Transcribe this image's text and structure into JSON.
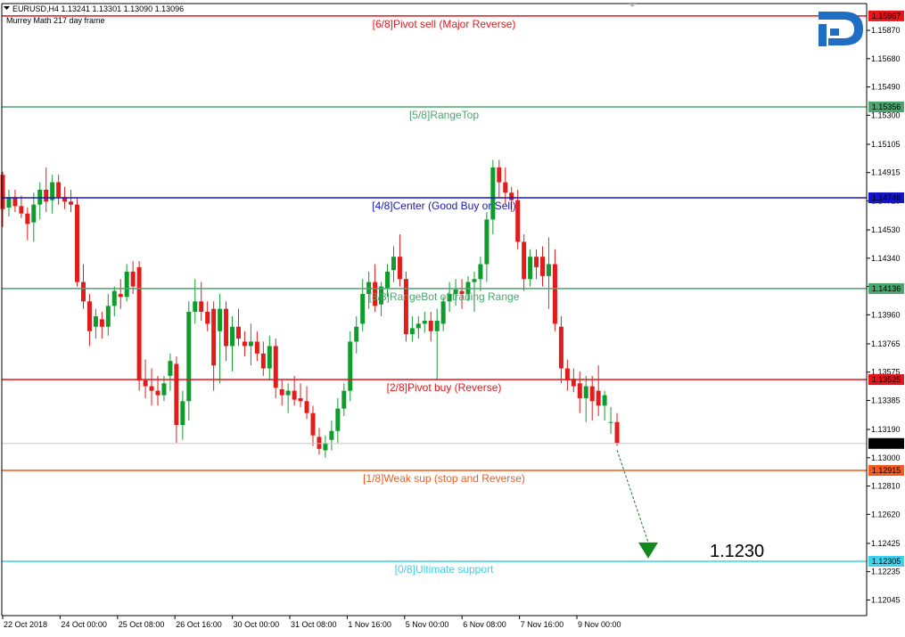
{
  "header": {
    "symbol_line": "EURUSD,H4  1.13241 1.13301 1.13090 1.13096",
    "indicator_name": "Murrey Math 217 day frame"
  },
  "chart_data": {
    "type": "candlestick",
    "symbol": "EURUSD",
    "timeframe": "H4",
    "ohlc_header": {
      "open": 1.13241,
      "high": 1.13301,
      "low": 1.1309,
      "close": 1.13096
    },
    "current_price": 1.13096,
    "ylim": [
      1.1194,
      1.1605
    ],
    "y_ticks": [
      "1.15870",
      "1.15680",
      "1.15490",
      "1.15300",
      "1.15105",
      "1.14915",
      "1.14725",
      "1.14530",
      "1.14340",
      "1.14150",
      "1.13960",
      "1.13765",
      "1.13575",
      "1.13385",
      "1.13190",
      "1.13000",
      "1.12810",
      "1.12620",
      "1.12425",
      "1.12235",
      "1.12045"
    ],
    "x_labels": [
      "22 Oct 2018",
      "24 Oct 00:00",
      "25 Oct 08:00",
      "26 Oct 16:00",
      "30 Oct 00:00",
      "31 Oct 08:00",
      "1 Nov 16:00",
      "5 Nov 00:00",
      "6 Nov 08:00",
      "7 Nov 16:00",
      "9 Nov 00:00"
    ],
    "levels": [
      {
        "label": "[6/8]Pivot sell (Major Reverse)",
        "value": 1.15967,
        "price_text": "1.15967",
        "color": "#e8141a"
      },
      {
        "label": "[5/8]RangeTop",
        "value": 1.15356,
        "price_text": "1.15356",
        "color": "#4aa56f"
      },
      {
        "label": "[4/8]Center (Good Buy or Sell)",
        "value": 1.14746,
        "price_text": "1.14746",
        "color": "#1414c8"
      },
      {
        "label": "[3/8]RangeBot of trading Range",
        "value": 1.14136,
        "price_text": "1.14136",
        "color": "#4aa56f"
      },
      {
        "label": "[2/8]Pivot buy (Reverse)",
        "value": 1.13525,
        "price_text": "1.13525",
        "color": "#e8141a"
      },
      {
        "label": "[1/8]Weak sup (stop and Reverse)",
        "value": 1.12915,
        "price_text": "1.12915",
        "color": "#f25a1e"
      },
      {
        "label": "[0/8]Ultimate support",
        "value": 1.12305,
        "price_text": "1.12305",
        "color": "#3ad2ee"
      }
    ],
    "target": {
      "label": "1.1230",
      "value": 1.123
    },
    "candles": [
      [
        1.149,
        1.1492,
        1.1455,
        1.1467
      ],
      [
        1.1468,
        1.148,
        1.1462,
        1.1475
      ],
      [
        1.1475,
        1.148,
        1.1465,
        1.1469
      ],
      [
        1.1469,
        1.1476,
        1.1461,
        1.1464
      ],
      [
        1.1464,
        1.1468,
        1.1446,
        1.1457
      ],
      [
        1.1458,
        1.1478,
        1.1445,
        1.147
      ],
      [
        1.147,
        1.1485,
        1.146,
        1.148
      ],
      [
        1.148,
        1.1495,
        1.1465,
        1.1472
      ],
      [
        1.1473,
        1.149,
        1.1464,
        1.1485
      ],
      [
        1.1485,
        1.149,
        1.147,
        1.1475
      ],
      [
        1.1475,
        1.1482,
        1.1467,
        1.1472
      ],
      [
        1.1472,
        1.148,
        1.1465,
        1.147
      ],
      [
        1.147,
        1.1475,
        1.1415,
        1.1418
      ],
      [
        1.1418,
        1.143,
        1.14,
        1.1405
      ],
      [
        1.1405,
        1.141,
        1.1375,
        1.1385
      ],
      [
        1.1388,
        1.14,
        1.138,
        1.1395
      ],
      [
        1.1393,
        1.1398,
        1.138,
        1.1388
      ],
      [
        1.1388,
        1.141,
        1.1382,
        1.1402
      ],
      [
        1.1402,
        1.1415,
        1.1395,
        1.1412
      ],
      [
        1.141,
        1.142,
        1.14,
        1.1408
      ],
      [
        1.1408,
        1.143,
        1.1405,
        1.1425
      ],
      [
        1.1425,
        1.1432,
        1.141,
        1.1415
      ],
      [
        1.1428,
        1.1432,
        1.1345,
        1.1352
      ],
      [
        1.1352,
        1.1366,
        1.134,
        1.1348
      ],
      [
        1.1348,
        1.136,
        1.1335,
        1.1345
      ],
      [
        1.1345,
        1.1355,
        1.1335,
        1.1342
      ],
      [
        1.1342,
        1.1355,
        1.1338,
        1.135
      ],
      [
        1.1355,
        1.137,
        1.1345,
        1.1365
      ],
      [
        1.1363,
        1.1368,
        1.131,
        1.1322
      ],
      [
        1.1322,
        1.1345,
        1.1312,
        1.1338
      ],
      [
        1.1338,
        1.1405,
        1.1325,
        1.1398
      ],
      [
        1.1398,
        1.142,
        1.139,
        1.1405
      ],
      [
        1.1405,
        1.1418,
        1.1392,
        1.1398
      ],
      [
        1.1398,
        1.1405,
        1.1385,
        1.139
      ],
      [
        1.14,
        1.1405,
        1.1345,
        1.1362
      ],
      [
        1.1385,
        1.141,
        1.135,
        1.14
      ],
      [
        1.14,
        1.1405,
        1.1365,
        1.1375
      ],
      [
        1.1375,
        1.1395,
        1.1358,
        1.1388
      ],
      [
        1.1388,
        1.14,
        1.1375,
        1.138
      ],
      [
        1.1378,
        1.1385,
        1.1368,
        1.1375
      ],
      [
        1.1375,
        1.139,
        1.1362,
        1.1378
      ],
      [
        1.1378,
        1.1385,
        1.1365,
        1.137
      ],
      [
        1.137,
        1.1378,
        1.1355,
        1.136
      ],
      [
        1.136,
        1.1382,
        1.1352,
        1.1375
      ],
      [
        1.1375,
        1.138,
        1.134,
        1.1347
      ],
      [
        1.1346,
        1.1352,
        1.1335,
        1.1342
      ],
      [
        1.1342,
        1.135,
        1.133,
        1.1345
      ],
      [
        1.1345,
        1.1355,
        1.1335,
        1.1339
      ],
      [
        1.134,
        1.135,
        1.1334,
        1.1338
      ],
      [
        1.1338,
        1.1348,
        1.1326,
        1.133
      ],
      [
        1.133,
        1.1335,
        1.1308,
        1.1315
      ],
      [
        1.1314,
        1.132,
        1.1302,
        1.1306
      ],
      [
        1.1305,
        1.1315,
        1.13,
        1.131
      ],
      [
        1.1312,
        1.1325,
        1.1305,
        1.1318
      ],
      [
        1.1318,
        1.134,
        1.131,
        1.1333
      ],
      [
        1.1333,
        1.135,
        1.1328,
        1.1345
      ],
      [
        1.1345,
        1.1385,
        1.1338,
        1.1378
      ],
      [
        1.1378,
        1.1395,
        1.137,
        1.1388
      ],
      [
        1.139,
        1.142,
        1.1385,
        1.141
      ],
      [
        1.141,
        1.1425,
        1.14,
        1.1418
      ],
      [
        1.1418,
        1.143,
        1.1398,
        1.1402
      ],
      [
        1.1403,
        1.1418,
        1.1395,
        1.1415
      ],
      [
        1.1414,
        1.143,
        1.1408,
        1.1425
      ],
      [
        1.1426,
        1.1442,
        1.1418,
        1.1435
      ],
      [
        1.1435,
        1.145,
        1.1415,
        1.142
      ],
      [
        1.142,
        1.1425,
        1.1378,
        1.1383
      ],
      [
        1.1383,
        1.1395,
        1.1378,
        1.1387
      ],
      [
        1.1387,
        1.1395,
        1.138,
        1.139
      ],
      [
        1.139,
        1.1398,
        1.1384,
        1.1392
      ],
      [
        1.1392,
        1.1398,
        1.1378,
        1.1385
      ],
      [
        1.1385,
        1.14,
        1.1352,
        1.1392
      ],
      [
        1.139,
        1.1408,
        1.1385,
        1.1405
      ],
      [
        1.1405,
        1.1418,
        1.1398,
        1.141
      ],
      [
        1.141,
        1.142,
        1.1402,
        1.1413
      ],
      [
        1.1412,
        1.142,
        1.14,
        1.141
      ],
      [
        1.141,
        1.1422,
        1.1405,
        1.1418
      ],
      [
        1.1418,
        1.1425,
        1.1398,
        1.142
      ],
      [
        1.142,
        1.1435,
        1.1412,
        1.143
      ],
      [
        1.143,
        1.1465,
        1.1418,
        1.146
      ],
      [
        1.146,
        1.15,
        1.145,
        1.1495
      ],
      [
        1.1495,
        1.15,
        1.1475,
        1.1485
      ],
      [
        1.1485,
        1.1495,
        1.147,
        1.1478
      ],
      [
        1.1478,
        1.1482,
        1.1465,
        1.1473
      ],
      [
        1.1473,
        1.148,
        1.144,
        1.1445
      ],
      [
        1.1445,
        1.145,
        1.1412,
        1.142
      ],
      [
        1.142,
        1.144,
        1.1415,
        1.1435
      ],
      [
        1.1435,
        1.144,
        1.142,
        1.1428
      ],
      [
        1.1435,
        1.1442,
        1.1415,
        1.1422
      ],
      [
        1.1422,
        1.1448,
        1.14,
        1.143
      ],
      [
        1.143,
        1.144,
        1.1385,
        1.139
      ],
      [
        1.1388,
        1.1395,
        1.135,
        1.136
      ],
      [
        1.136,
        1.1366,
        1.1345,
        1.1352
      ],
      [
        1.1353,
        1.136,
        1.1344,
        1.1348
      ],
      [
        1.135,
        1.1358,
        1.133,
        1.134
      ],
      [
        1.134,
        1.1355,
        1.1324,
        1.1348
      ],
      [
        1.1348,
        1.1355,
        1.1325,
        1.1338
      ],
      [
        1.1345,
        1.1362,
        1.1328,
        1.1335
      ],
      [
        1.1335,
        1.1345,
        1.1325,
        1.1342
      ],
      [
        1.1324,
        1.1334,
        1.1316,
        1.1324
      ],
      [
        1.1324,
        1.133,
        1.1308,
        1.131
      ]
    ]
  }
}
